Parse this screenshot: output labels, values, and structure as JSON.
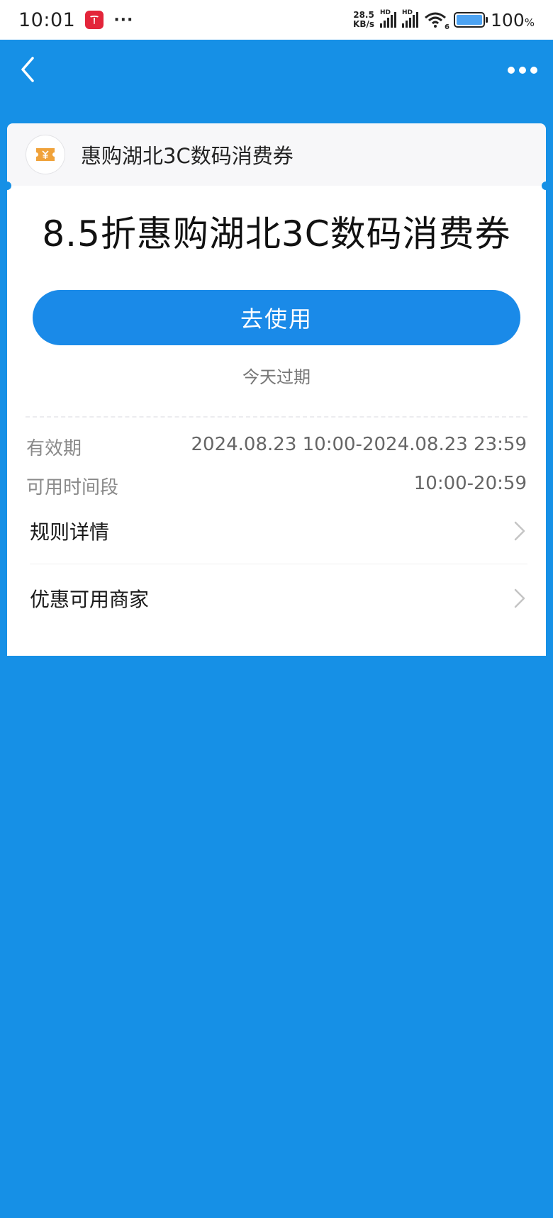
{
  "status_bar": {
    "time": "10:01",
    "app_icon": "tesla-app-icon",
    "more_dots": "···",
    "net_speed_value": "28.5",
    "net_speed_unit": "KB/s",
    "signal_label_1": "HD",
    "signal_label_2": "HD",
    "wifi_label": "6",
    "battery_percent": "100",
    "battery_percent_unit": "%",
    "battery_level": 1.0
  },
  "nav": {
    "back_icon": "chevron-left-icon",
    "more_icon": "more-dots-icon"
  },
  "card_header": {
    "icon": "coupon-ticket-icon",
    "title": "惠购湖北3C数码消费券"
  },
  "coupon": {
    "title": "8.5折惠购湖北3C数码消费券",
    "use_button_label": "去使用",
    "expire_note": "今天过期",
    "validity_label": "有效期",
    "validity_value": "2024.08.23 10:00-2024.08.23 23:59",
    "time_slot_label": "可用时间段",
    "time_slot_value": "10:00-20:59"
  },
  "links": [
    {
      "label": "规则详情",
      "icon": "chevron-right-icon"
    },
    {
      "label": "优惠可用商家",
      "icon": "chevron-right-icon"
    }
  ],
  "colors": {
    "primary_blue": "#1690e6",
    "button_blue": "#1a8ae8",
    "coupon_icon_orange": "#f0a23a"
  }
}
